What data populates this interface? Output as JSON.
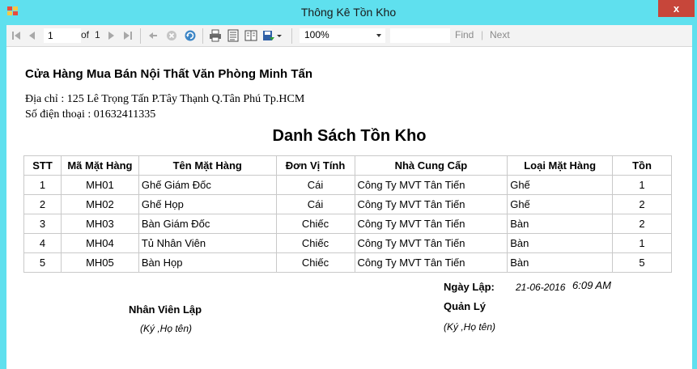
{
  "window": {
    "title": "Thông Kê Tồn Kho",
    "close_glyph": "x"
  },
  "toolbar": {
    "page_current": "1",
    "page_of_label": "of",
    "page_total": "1",
    "zoom_value": "100%",
    "find_input_value": "",
    "find_label": "Find",
    "find_separator": "|",
    "next_label": "Next"
  },
  "report": {
    "company": "Cửa Hàng Mua Bán Nội Thất Văn Phòng Minh Tấn",
    "address": "Địa chỉ : 125 Lê Trọng Tấn P.Tây Thạnh Q.Tân Phú Tp.HCM",
    "phone": "Số điện thoại : 01632411335",
    "title": "Danh Sách Tồn Kho",
    "columns": [
      "STT",
      "Mã Mặt Hàng",
      "Tên Mặt Hàng",
      "Đơn Vị Tính",
      "Nhà Cung Cấp",
      "Loại Mặt Hàng",
      "Tồn"
    ],
    "rows": [
      [
        "1",
        "MH01",
        "Ghế Giám Đốc",
        "Cái",
        "Công Ty MVT Tân Tiến",
        "Ghế",
        "1"
      ],
      [
        "2",
        "MH02",
        "Ghế Họp",
        "Cái",
        "Công Ty MVT Tân Tiến",
        "Ghế",
        "2"
      ],
      [
        "3",
        "MH03",
        "Bàn Giám Đốc",
        "Chiếc",
        "Công Ty MVT Tân Tiến",
        "Bàn",
        "2"
      ],
      [
        "4",
        "MH04",
        "Tủ Nhân Viên",
        "Chiếc",
        "Công Ty MVT Tân Tiến",
        "Bàn",
        "1"
      ],
      [
        "5",
        "MH05",
        "Bàn Họp",
        "Chiếc",
        "Công Ty MVT Tân Tiến",
        "Bàn",
        "5"
      ]
    ],
    "signatures": {
      "date_label": "Ngày Lập:",
      "date_value": "21-06-2016",
      "time_value": "6:09 AM",
      "staff_label": "Nhân Viên Lập",
      "staff_note": "(Ký ,Họ tên)",
      "manager_label": "Quản Lý",
      "manager_note": "(Ký ,Họ tên)"
    }
  },
  "colors": {
    "titlebar": "#5fe0ee",
    "close_button": "#c7463a",
    "toolbar": "#f3f3f3",
    "report_bg": "#ffffff"
  },
  "icons": [
    "app-icon",
    "first-page-icon",
    "prev-page-icon",
    "next-page-icon",
    "last-page-icon",
    "back-icon",
    "stop-icon",
    "refresh-icon",
    "print-icon",
    "print-layout-icon",
    "page-setup-icon",
    "export-icon"
  ]
}
